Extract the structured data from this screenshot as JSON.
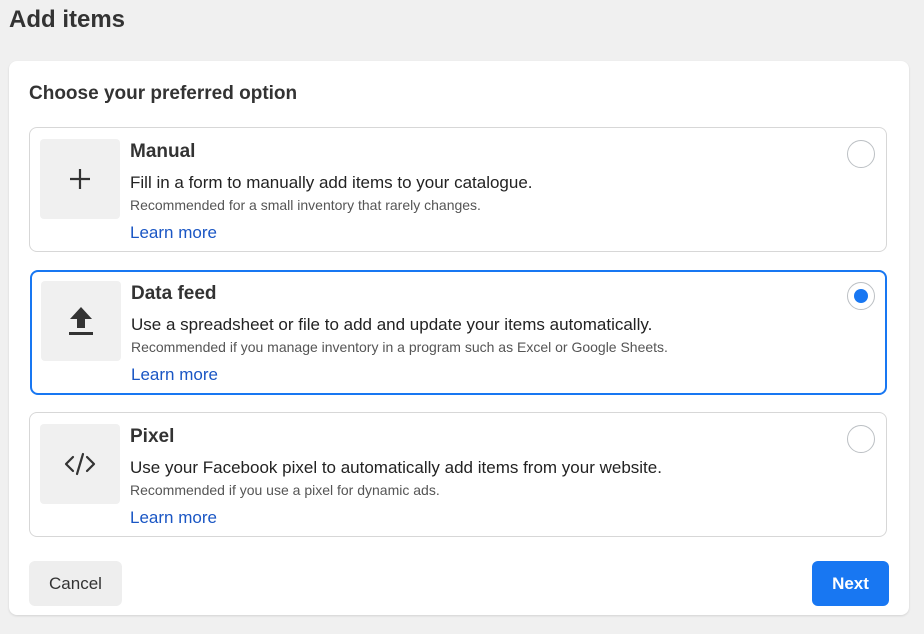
{
  "page": {
    "title": "Add items"
  },
  "panel": {
    "heading": "Choose your preferred option"
  },
  "options": [
    {
      "title": "Manual",
      "description": "Fill in a form to manually add items to your catalogue.",
      "sub": "Recommended for a small inventory that rarely changes.",
      "link": "Learn more",
      "icon": "plus-icon",
      "selected": false
    },
    {
      "title": "Data feed",
      "description": "Use a spreadsheet or file to add and update your items automatically.",
      "sub": "Recommended if you manage inventory in a program such as Excel or Google Sheets.",
      "link": "Learn more",
      "icon": "upload-icon",
      "selected": true
    },
    {
      "title": "Pixel",
      "description": "Use your Facebook pixel to automatically add items from your website.",
      "sub": "Recommended if you use a pixel for dynamic ads.",
      "link": "Learn more",
      "icon": "code-icon",
      "selected": false
    }
  ],
  "footer": {
    "cancel_label": "Cancel",
    "next_label": "Next"
  },
  "colors": {
    "accent": "#1877f2",
    "link": "#1a56c4",
    "background": "#f0f0f0"
  }
}
